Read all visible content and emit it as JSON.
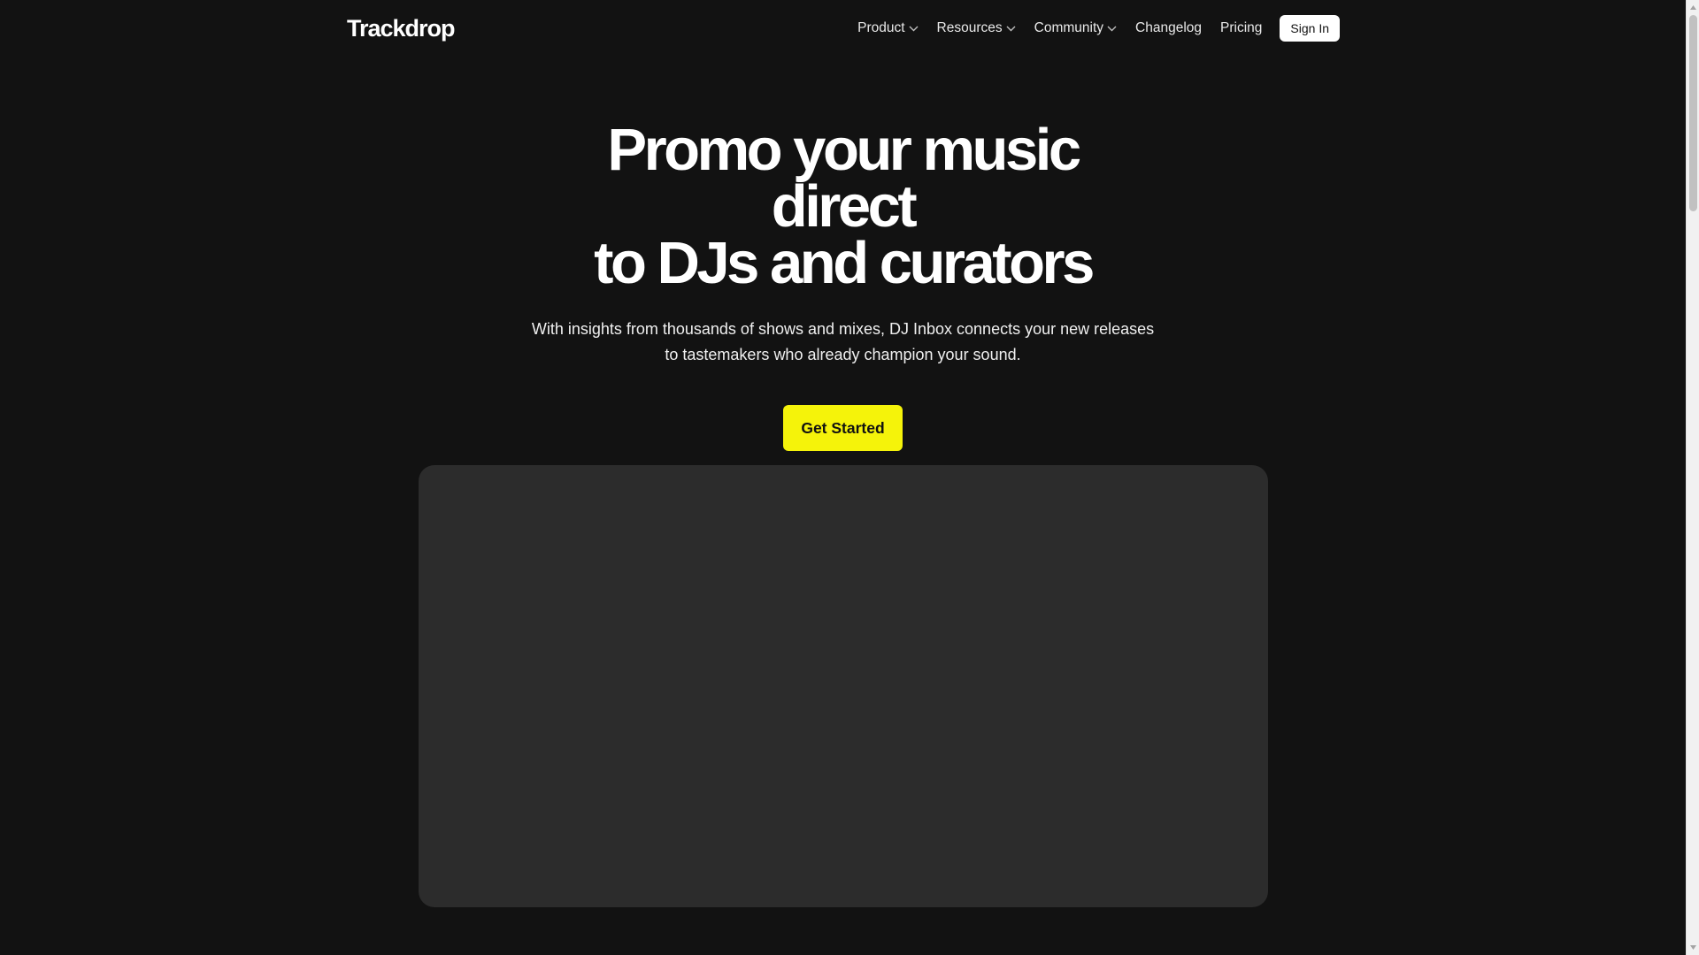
{
  "brand": {
    "name": "Trackdrop"
  },
  "nav": {
    "items": [
      {
        "label": "Product",
        "dropdown": true
      },
      {
        "label": "Resources",
        "dropdown": true
      },
      {
        "label": "Community",
        "dropdown": true
      },
      {
        "label": "Changelog",
        "dropdown": false
      },
      {
        "label": "Pricing",
        "dropdown": false
      }
    ],
    "signin_label": "Sign In"
  },
  "hero": {
    "title_line1": "Promo your music direct",
    "title_line2": "to DJs and curators",
    "subtitle": "With insights from thousands of shows and mixes, DJ Inbox connects your new releases to tastemakers who already champion your sound.",
    "cta_label": "Get Started"
  },
  "colors": {
    "background": "#121212",
    "accent": "#f5f30a",
    "panel": "#2c2c2c"
  },
  "icons": {
    "dropdown": "chevron-down-icon"
  }
}
